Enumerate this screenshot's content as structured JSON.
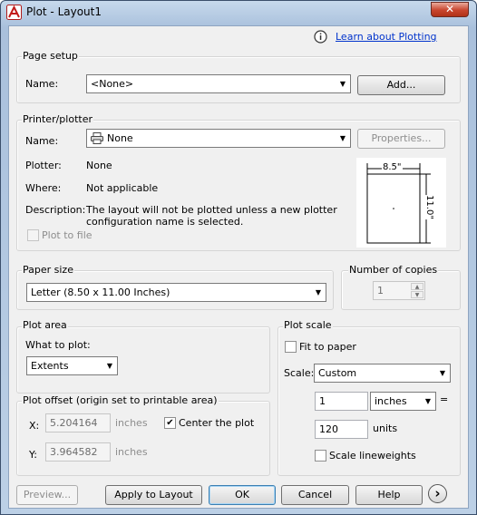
{
  "window": {
    "title": "Plot - Layout1",
    "close_symbol": "✕"
  },
  "learn_link": "Learn about Plotting",
  "page_setup": {
    "title": "Page setup",
    "name_label": "Name:",
    "name_value": "<None>",
    "add_button": "Add..."
  },
  "printer": {
    "title": "Printer/plotter",
    "name_label": "Name:",
    "name_value": "None",
    "properties_button": "Properties...",
    "plotter_label": "Plotter:",
    "plotter_value": "None",
    "where_label": "Where:",
    "where_value": "Not applicable",
    "description_label": "Description:",
    "description_line1": "The layout will not be plotted unless a new plotter",
    "description_line2": "configuration name is selected.",
    "plot_to_file_label": "Plot to file",
    "preview_width": "8.5\"",
    "preview_height": "11.0\""
  },
  "paper_size": {
    "title": "Paper size",
    "value": "Letter (8.50 x 11.00 Inches)"
  },
  "copies": {
    "title": "Number of copies",
    "value": "1"
  },
  "plot_area": {
    "title": "Plot area",
    "what_label": "What to plot:",
    "what_value": "Extents"
  },
  "plot_offset": {
    "title": "Plot offset (origin set to printable area)",
    "x_label": "X:",
    "x_value": "5.204164",
    "x_unit": "inches",
    "y_label": "Y:",
    "y_value": "3.964582",
    "y_unit": "inches",
    "center_label": "Center the plot",
    "center_checked": true
  },
  "plot_scale": {
    "title": "Plot scale",
    "fit_label": "Fit to paper",
    "fit_checked": false,
    "scale_label": "Scale:",
    "scale_value": "Custom",
    "value1": "1",
    "unit1": "inches",
    "equals": "=",
    "value2": "120",
    "unit2": "units",
    "lineweights_label": "Scale lineweights",
    "lineweights_checked": false
  },
  "footer": {
    "preview": "Preview...",
    "apply": "Apply to Layout",
    "ok": "OK",
    "cancel": "Cancel",
    "help": "Help",
    "expand_symbol": "›"
  }
}
